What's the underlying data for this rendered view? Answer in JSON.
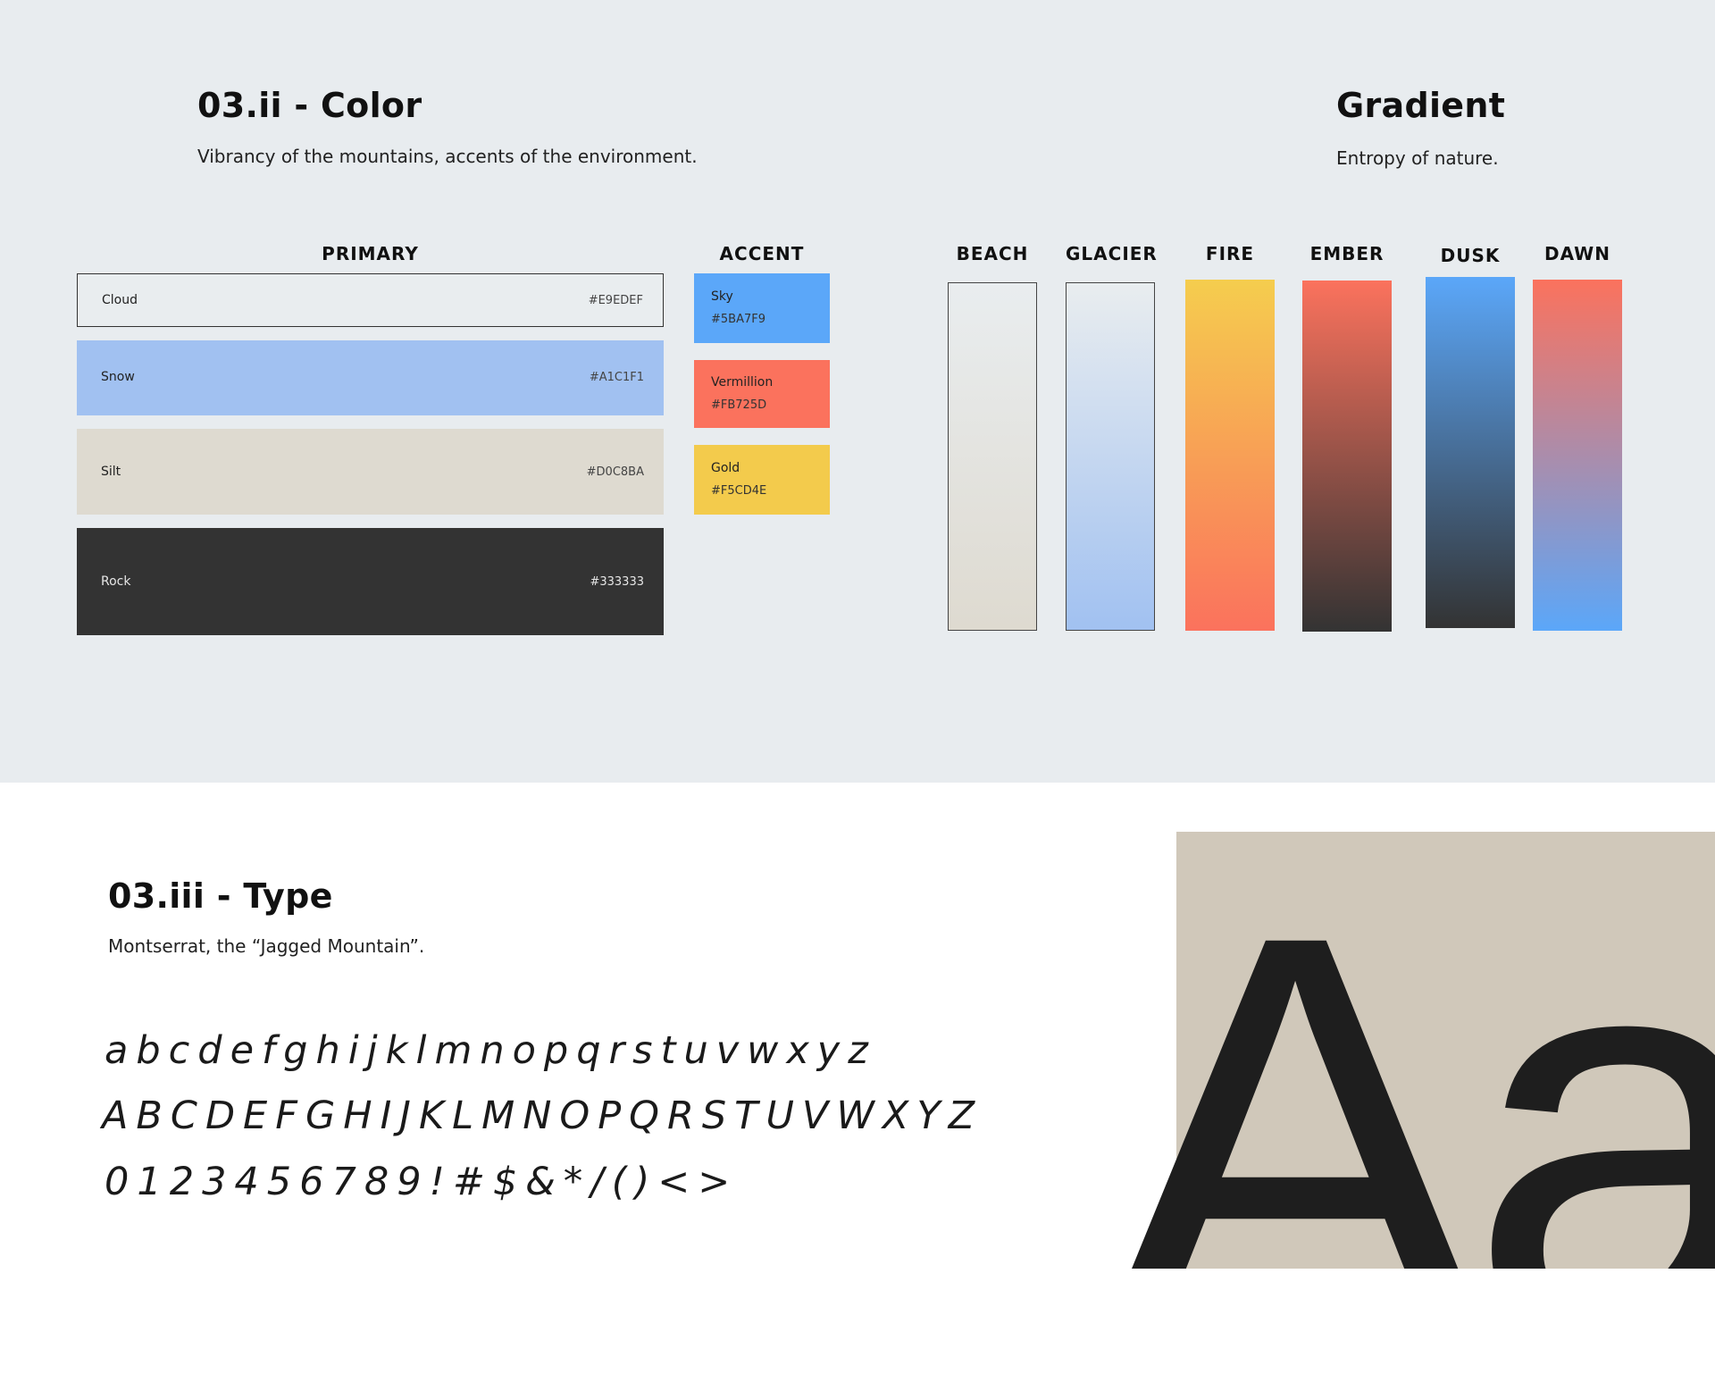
{
  "color_section": {
    "title": "03.ii - Color",
    "subtitle": "Vibrancy of the mountains, accents of the environment.",
    "primary": {
      "heading": "PRIMARY",
      "swatches": [
        {
          "name": "Cloud",
          "hex": "#E9EDEF",
          "color": "#E9EDEF"
        },
        {
          "name": "Snow",
          "hex": "#A1C1F1",
          "color": "#A1C1F1"
        },
        {
          "name": "Silt",
          "hex": "#D0C8BA",
          "color": "#DEDAD0"
        },
        {
          "name": "Rock",
          "hex": "#333333",
          "color": "#333333"
        }
      ]
    },
    "accent": {
      "heading": "ACCENT",
      "swatches": [
        {
          "name": "Sky",
          "hex": "#5BA7F9",
          "color": "#5BA7F9"
        },
        {
          "name": "Vermillion",
          "hex": "#FB725D",
          "color": "#FB725D"
        },
        {
          "name": "Gold",
          "hex": "#F5CD4E",
          "color": "#F3CB4C"
        }
      ]
    }
  },
  "gradient_section": {
    "title": "Gradient",
    "subtitle": "Entropy of nature.",
    "gradients": [
      {
        "name": "BEACH",
        "from": "#E9EDEF",
        "to": "#DEDAD0"
      },
      {
        "name": "GLACIER",
        "from": "#E9EDEF",
        "to": "#A1C1F1"
      },
      {
        "name": "FIRE",
        "from": "#F5CD4E",
        "to": "#FB725D"
      },
      {
        "name": "EMBER",
        "from": "#FB725D",
        "to": "#333333"
      },
      {
        "name": "DUSK",
        "from": "#5BA7F9",
        "to": "#333333"
      },
      {
        "name": "DAWN",
        "from": "#FB725D",
        "to": "#5BA7F9"
      }
    ]
  },
  "type_section": {
    "title": "03.iii - Type",
    "subtitle": "Montserrat, the “Jagged Mountain”.",
    "lowercase": "abcdefghijklmnopqrstuvwxyz",
    "uppercase": "ABCDEFGHIJKLMNOPQRSTUVWXYZ",
    "numerals": "0123456789!#$&*/()<>",
    "specimen": "Aa",
    "specimen_bg": "#D0C8BA"
  }
}
